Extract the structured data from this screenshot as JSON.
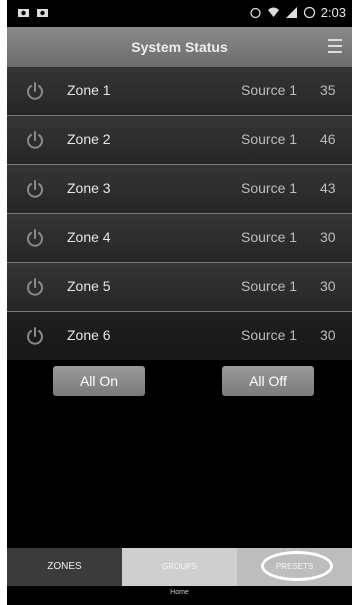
{
  "status_bar": {
    "time": "2:03"
  },
  "header": {
    "title": "System Status"
  },
  "zones": [
    {
      "name": "Zone 1",
      "source": "Source 1",
      "volume": "35"
    },
    {
      "name": "Zone 2",
      "source": "Source 1",
      "volume": "46"
    },
    {
      "name": "Zone 3",
      "source": "Source 1",
      "volume": "43"
    },
    {
      "name": "Zone 4",
      "source": "Source 1",
      "volume": "30"
    },
    {
      "name": "Zone 5",
      "source": "Source 1",
      "volume": "30"
    },
    {
      "name": "Zone 6",
      "source": "Source 1",
      "volume": "30"
    }
  ],
  "actions": {
    "all_on": "All On",
    "all_off": "All Off"
  },
  "tabs": [
    {
      "label": "ZONES"
    },
    {
      "label": "GROUPS"
    },
    {
      "label": "PRESETS"
    }
  ],
  "home_label": "Home"
}
